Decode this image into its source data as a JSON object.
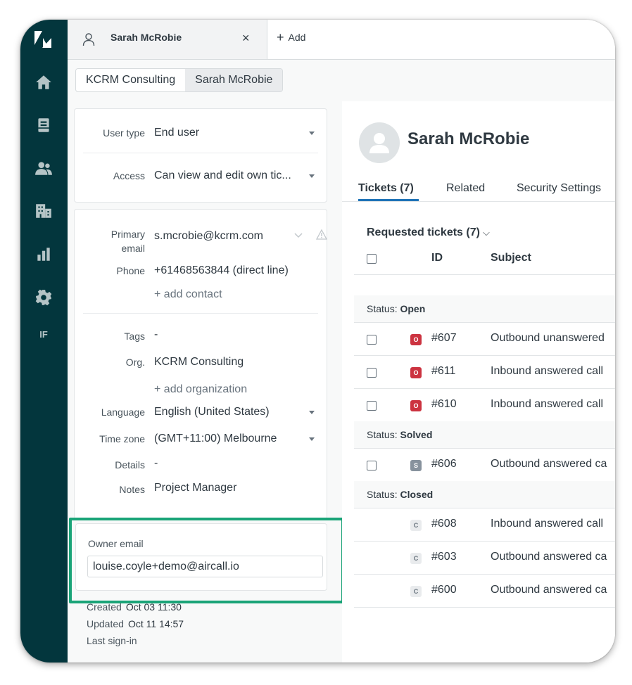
{
  "tabs": {
    "user_tab_label": "Sarah McRobie",
    "close_glyph": "×",
    "add_label": "Add",
    "add_glyph": "+"
  },
  "breadcrumb": [
    "KCRM Consulting",
    "Sarah McRobie"
  ],
  "rail": {
    "items": [
      "home-icon",
      "views-icon",
      "customers-icon",
      "organizations-icon",
      "reporting-icon",
      "admin-gear-icon"
    ],
    "apps_label": "IF"
  },
  "user_settings": {
    "user_type_label": "User type",
    "user_type_value": "End user",
    "access_label": "Access",
    "access_value": "Can view and edit own tic..."
  },
  "contact": {
    "primary_email_label_line1": "Primary",
    "primary_email_label_line2": "email",
    "primary_email_value": "s.mcrobie@kcrm.com",
    "phone_label": "Phone",
    "phone_value": "+61468563844 (direct line)",
    "add_contact": "+ add contact"
  },
  "details": {
    "tags_label": "Tags",
    "tags_value": "-",
    "org_label": "Org.",
    "org_value": "KCRM Consulting",
    "add_org": "+ add organization",
    "language_label": "Language",
    "language_value": "English (United States)",
    "timezone_label": "Time zone",
    "timezone_value": "(GMT+11:00) Melbourne",
    "details_label": "Details",
    "details_value": "-",
    "notes_label": "Notes",
    "notes_value": "Project Manager"
  },
  "owner": {
    "label": "Owner email",
    "value": "louise.coyle+demo@aircall.io",
    "highlight_color": "#1aa478"
  },
  "meta": {
    "created_label": "Created",
    "created_value": "Oct 03 11:30",
    "updated_label": "Updated",
    "updated_value": "Oct 11 14:57",
    "last_signin_label": "Last sign-in"
  },
  "profile": {
    "name": "Sarah McRobie",
    "tabs": [
      "Tickets (7)",
      "Related",
      "Security Settings"
    ]
  },
  "tickets": {
    "heading": "Requested tickets (7)",
    "chevron": "⌵",
    "columns": {
      "id": "ID",
      "subject": "Subject"
    },
    "status_prefix": "Status:",
    "groups": [
      {
        "status": "Open",
        "rows": [
          {
            "badge": "O",
            "id": "#607",
            "subject": "Outbound unanswered"
          },
          {
            "badge": "O",
            "id": "#611",
            "subject": "Inbound answered call"
          },
          {
            "badge": "O",
            "id": "#610",
            "subject": "Inbound answered call"
          }
        ]
      },
      {
        "status": "Solved",
        "rows": [
          {
            "badge": "S",
            "id": "#606",
            "subject": "Outbound answered ca"
          }
        ]
      },
      {
        "status": "Closed",
        "rows": [
          {
            "badge": "C",
            "id": "#608",
            "subject": "Inbound answered call"
          },
          {
            "badge": "C",
            "id": "#603",
            "subject": "Outbound answered ca"
          },
          {
            "badge": "C",
            "id": "#600",
            "subject": "Outbound answered ca"
          }
        ]
      }
    ]
  },
  "colors": {
    "rail": "#03363d",
    "accent_blue": "#1f73b7",
    "open": "#cc3340",
    "solved": "#87929d"
  }
}
